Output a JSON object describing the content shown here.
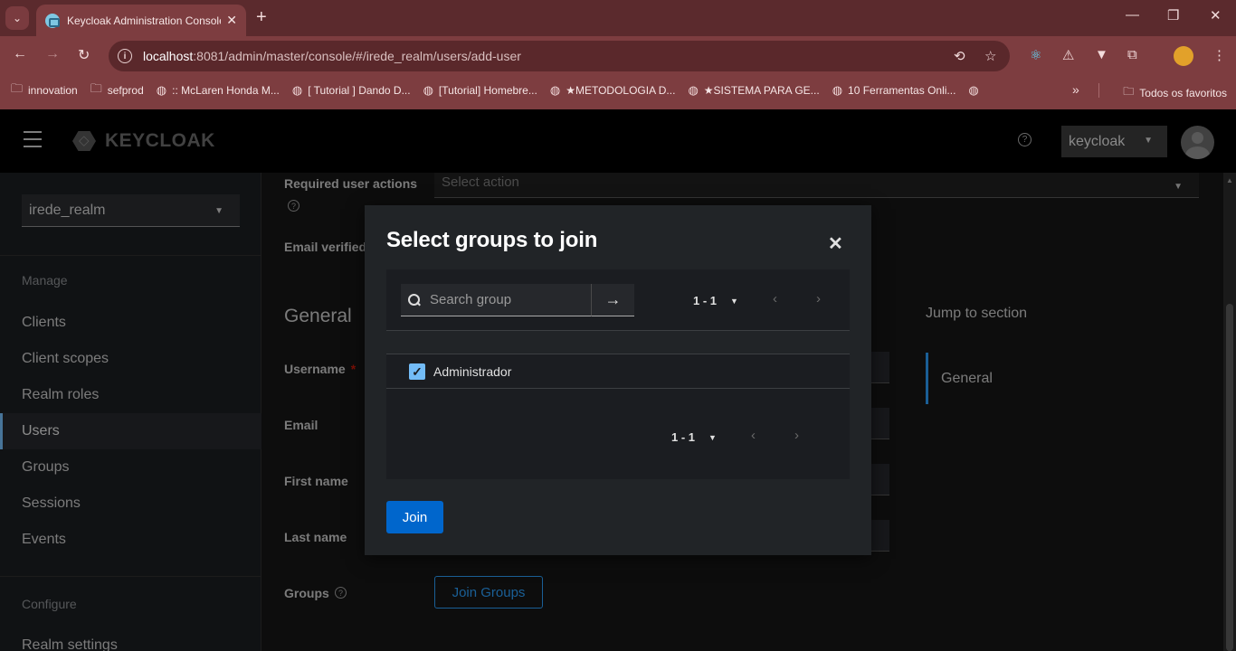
{
  "browser": {
    "tab_title": "Keycloak Administration Console",
    "new_tab": "+",
    "url_host": "localhost",
    "url_path": ":8081/admin/master/console/#/irede_realm/users/add-user",
    "bookmarks": [
      {
        "icon": "folder-icon",
        "label": "innovation"
      },
      {
        "icon": "folder-icon",
        "label": "sefprod"
      },
      {
        "icon": "globe-icon",
        "label": ":: McLaren Honda M..."
      },
      {
        "icon": "globe-icon",
        "label": "[ Tutorial ] Dando D..."
      },
      {
        "icon": "globe-icon",
        "label": "[Tutorial] Homebre..."
      },
      {
        "icon": "globe-icon",
        "label": "★METODOLOGIA D..."
      },
      {
        "icon": "globe-icon",
        "label": "★SISTEMA PARA GE..."
      },
      {
        "icon": "globe-icon",
        "label": "10 Ferramentas Onli..."
      }
    ],
    "all_bookmarks": "Todos os favoritos"
  },
  "header": {
    "logo_text": "KEYCLOAK",
    "user_menu": "keycloak"
  },
  "sidebar": {
    "realm": "irede_realm",
    "manage_label": "Manage",
    "configure_label": "Configure",
    "items": [
      {
        "label": "Clients",
        "active": false
      },
      {
        "label": "Client scopes",
        "active": false
      },
      {
        "label": "Realm roles",
        "active": false
      },
      {
        "label": "Users",
        "active": true
      },
      {
        "label": "Groups",
        "active": false
      },
      {
        "label": "Sessions",
        "active": false
      },
      {
        "label": "Events",
        "active": false
      }
    ],
    "realm_settings": "Realm settings"
  },
  "form": {
    "required_actions_label": "Required user actions",
    "required_actions_placeholder": "Select action",
    "email_verified_label": "Email verified",
    "section_title": "General",
    "username_label": "Username",
    "required_mark": "*",
    "email_label": "Email",
    "first_name_label": "First name",
    "last_name_label": "Last name",
    "groups_label": "Groups",
    "join_groups_button": "Join Groups",
    "jump_title": "Jump to section",
    "jump_general": "General"
  },
  "modal": {
    "title": "Select groups to join",
    "search_placeholder": "Search group",
    "pager_top": "1 - 1",
    "pager_bottom": "1 - 1",
    "groups": [
      {
        "name": "Administrador",
        "checked": true
      }
    ],
    "join_button": "Join"
  },
  "colors": {
    "accent": "#0066cc",
    "link_blue": "#2b9af3",
    "browser_frame": "#7d3d40"
  }
}
